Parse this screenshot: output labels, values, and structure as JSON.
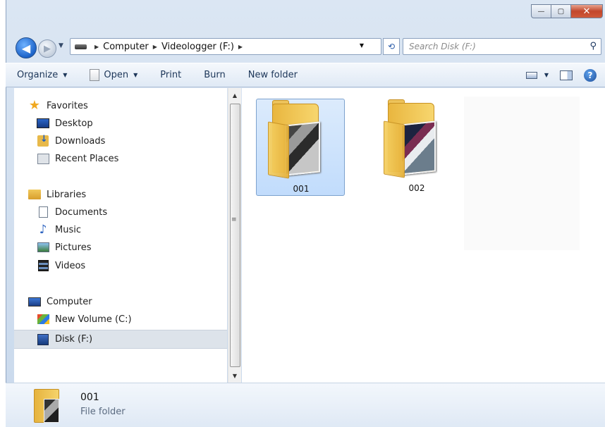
{
  "window": {
    "minimize_label": "—",
    "maximize_label": "▢",
    "close_label": "✕"
  },
  "address": {
    "crumbs": [
      "Computer",
      "Videologger (F:)"
    ],
    "back_glyph": "◀",
    "forward_glyph": "▶",
    "refresh_glyph": "⟲"
  },
  "search": {
    "placeholder": "Search Disk (F:)"
  },
  "toolbar": {
    "organize": "Organize",
    "open": "Open",
    "print": "Print",
    "burn": "Burn",
    "new_folder": "New folder",
    "help_glyph": "?"
  },
  "navigation": {
    "favorites": {
      "label": "Favorites",
      "items": [
        "Desktop",
        "Downloads",
        "Recent Places"
      ]
    },
    "libraries": {
      "label": "Libraries",
      "items": [
        "Documents",
        "Music",
        "Pictures",
        "Videos"
      ]
    },
    "computer": {
      "label": "Computer",
      "items": [
        "New Volume (C:)",
        "Disk (F:)"
      ],
      "selected": "Disk (F:)"
    }
  },
  "content": {
    "items": [
      {
        "name": "001",
        "selected": true
      },
      {
        "name": "002",
        "selected": false
      }
    ]
  },
  "details": {
    "name": "001",
    "type": "File folder"
  }
}
